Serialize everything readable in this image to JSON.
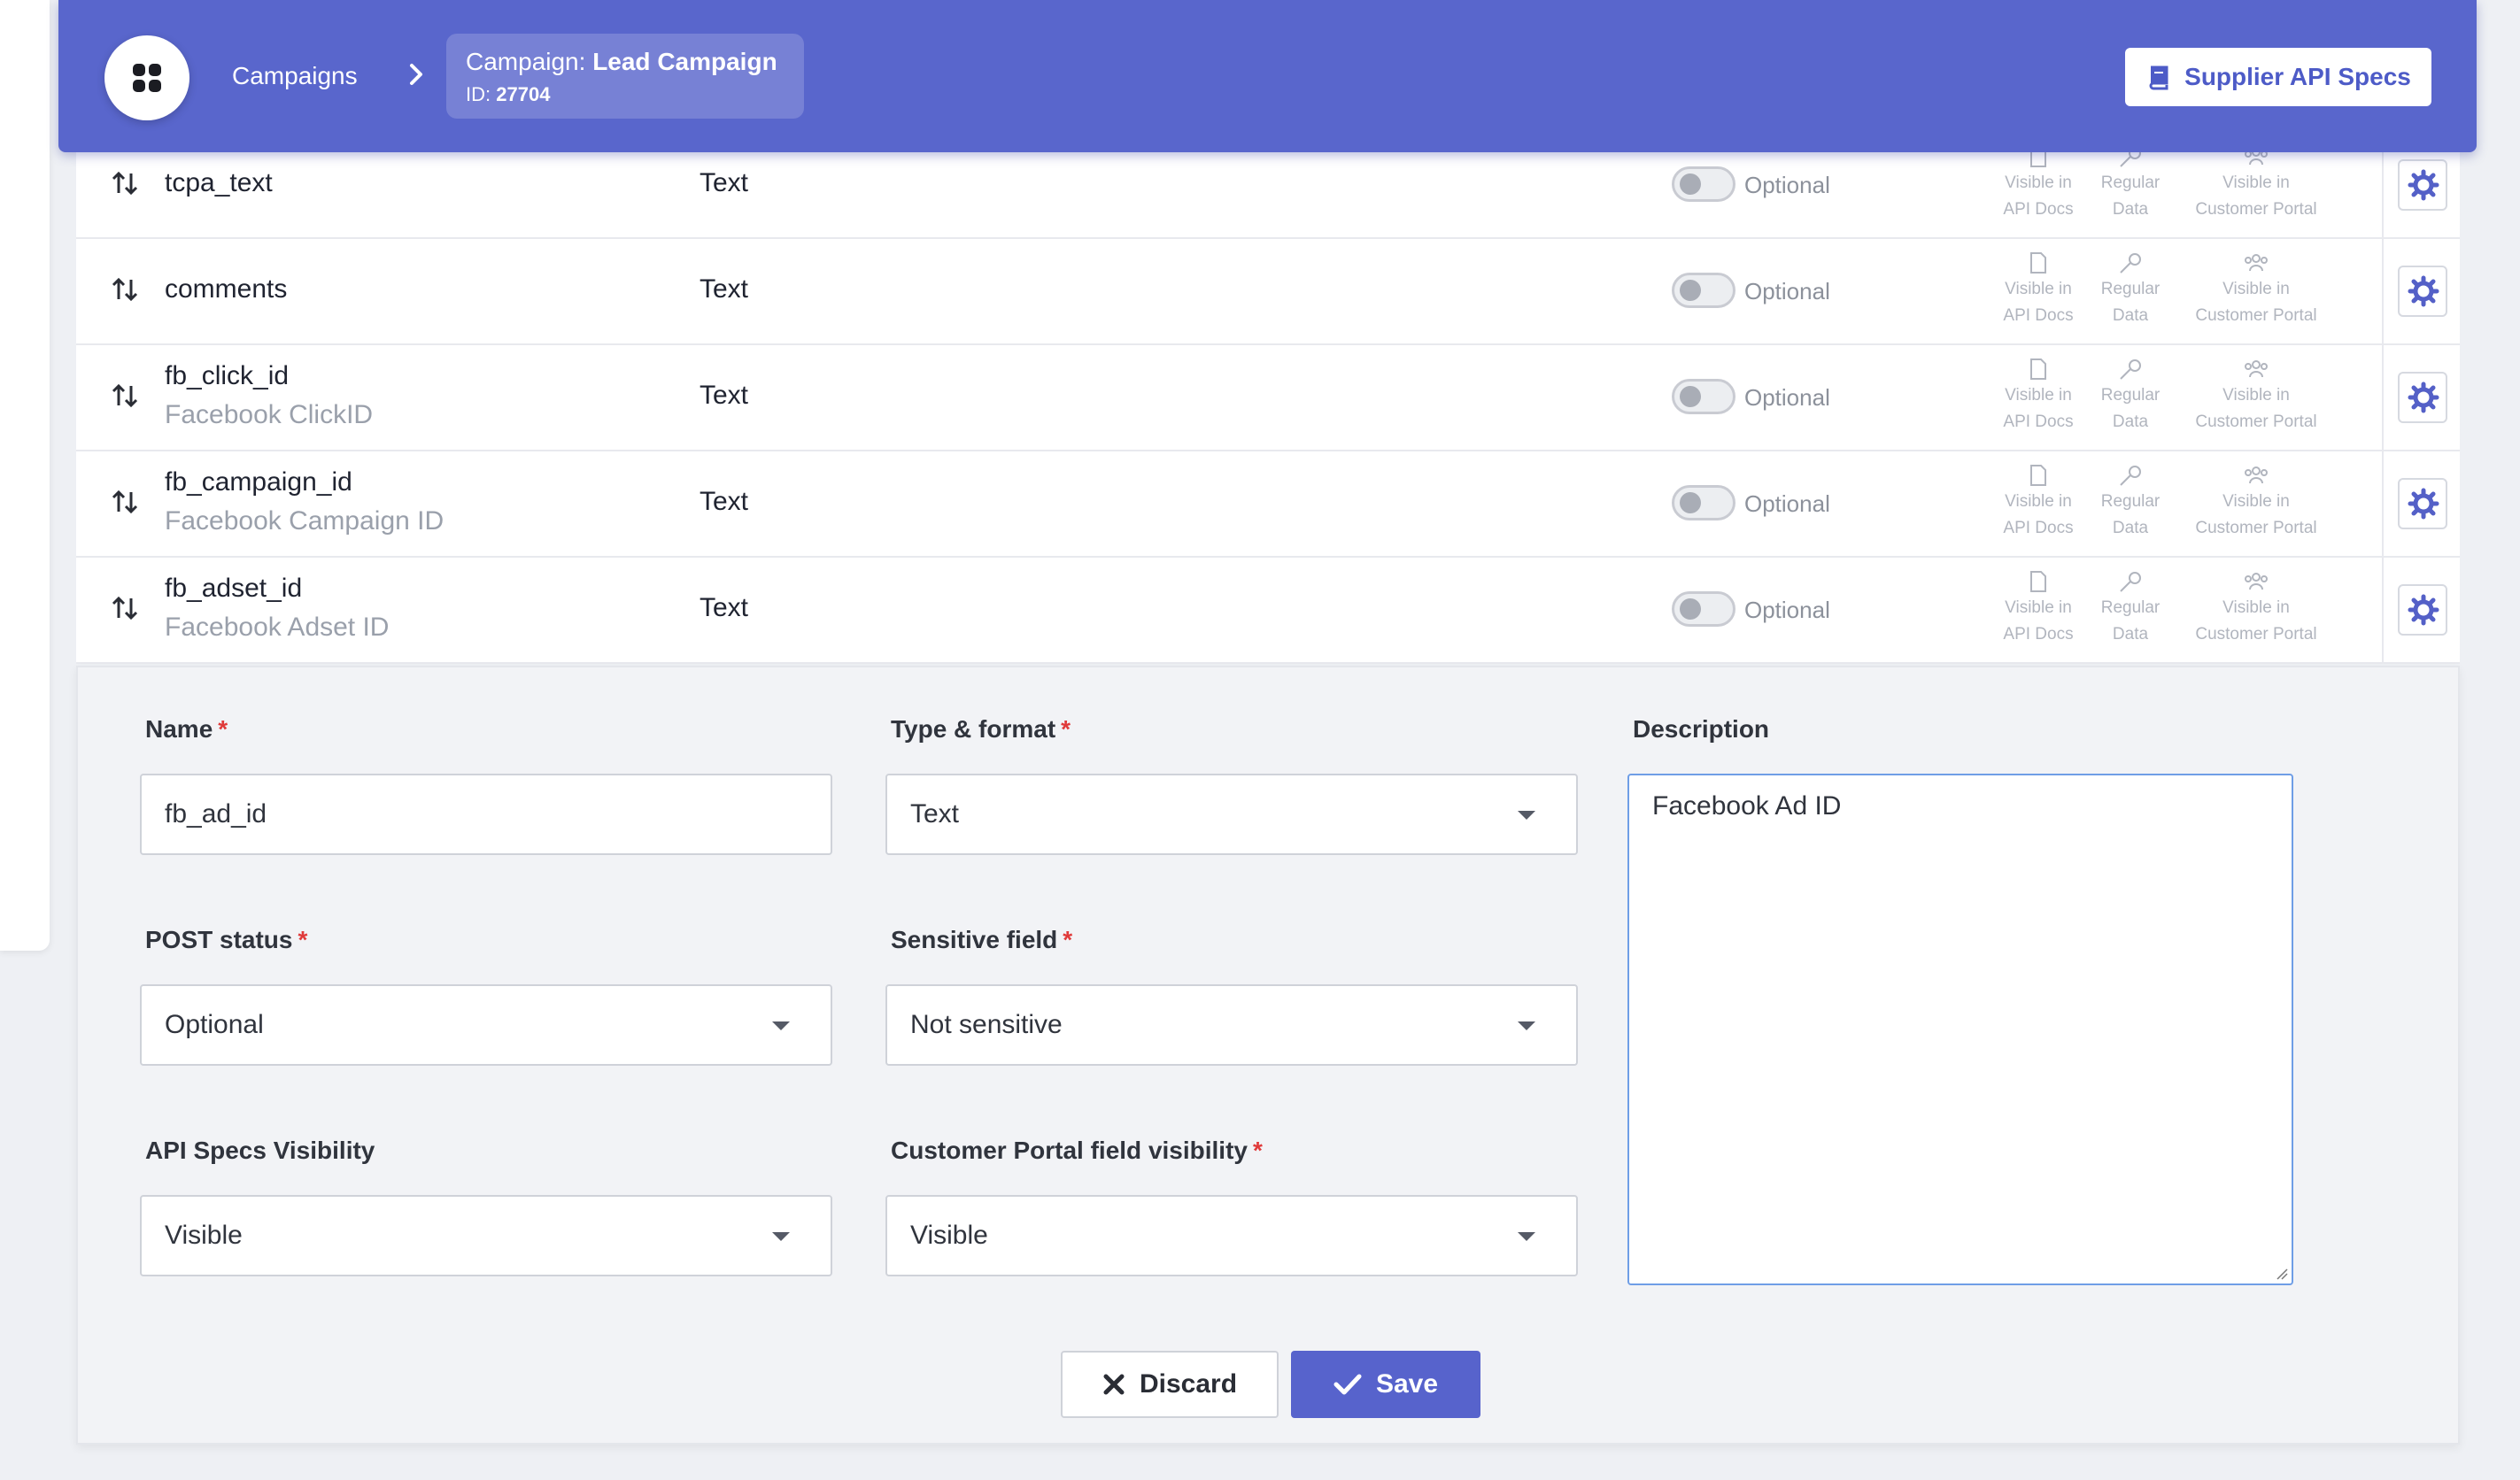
{
  "header": {
    "breadcrumb_link": "Campaigns",
    "campaign_prefix": "Campaign:",
    "campaign_name": "Lead Campaign",
    "id_prefix": "ID:",
    "campaign_id": "27704",
    "api_specs_label": "Supplier API Specs"
  },
  "rows": [
    {
      "name": "tcpa_text",
      "description": "",
      "type": "Text",
      "post_status": "Optional"
    },
    {
      "name": "comments",
      "description": "",
      "type": "Text",
      "post_status": "Optional"
    },
    {
      "name": "fb_click_id",
      "description": "Facebook ClickID",
      "type": "Text",
      "post_status": "Optional"
    },
    {
      "name": "fb_campaign_id",
      "description": "Facebook Campaign ID",
      "type": "Text",
      "post_status": "Optional"
    },
    {
      "name": "fb_adset_id",
      "description": "Facebook Adset ID",
      "type": "Text",
      "post_status": "Optional"
    }
  ],
  "row_meta": {
    "api_docs_l1": "Visible in",
    "api_docs_l2": "API Docs",
    "data_l1": "Regular",
    "data_l2": "Data",
    "portal_l1": "Visible in",
    "portal_l2": "Customer Portal"
  },
  "form": {
    "name_label": "Name",
    "name_value": "fb_ad_id",
    "type_label": "Type & format",
    "type_value": "Text",
    "description_label": "Description",
    "description_value": "Facebook Ad ID",
    "post_status_label": "POST status",
    "post_status_value": "Optional",
    "sensitive_label": "Sensitive field",
    "sensitive_value": "Not sensitive",
    "api_vis_label": "API Specs Visibility",
    "api_vis_value": "Visible",
    "portal_vis_label": "Customer Portal field visibility",
    "portal_vis_value": "Visible",
    "required_mark": "*",
    "discard_label": "Discard",
    "save_label": "Save"
  },
  "colors": {
    "header_bg": "#5966cc",
    "primary": "#5763cc",
    "required": "#e03a3a",
    "focus_border": "#6f9ee6"
  }
}
